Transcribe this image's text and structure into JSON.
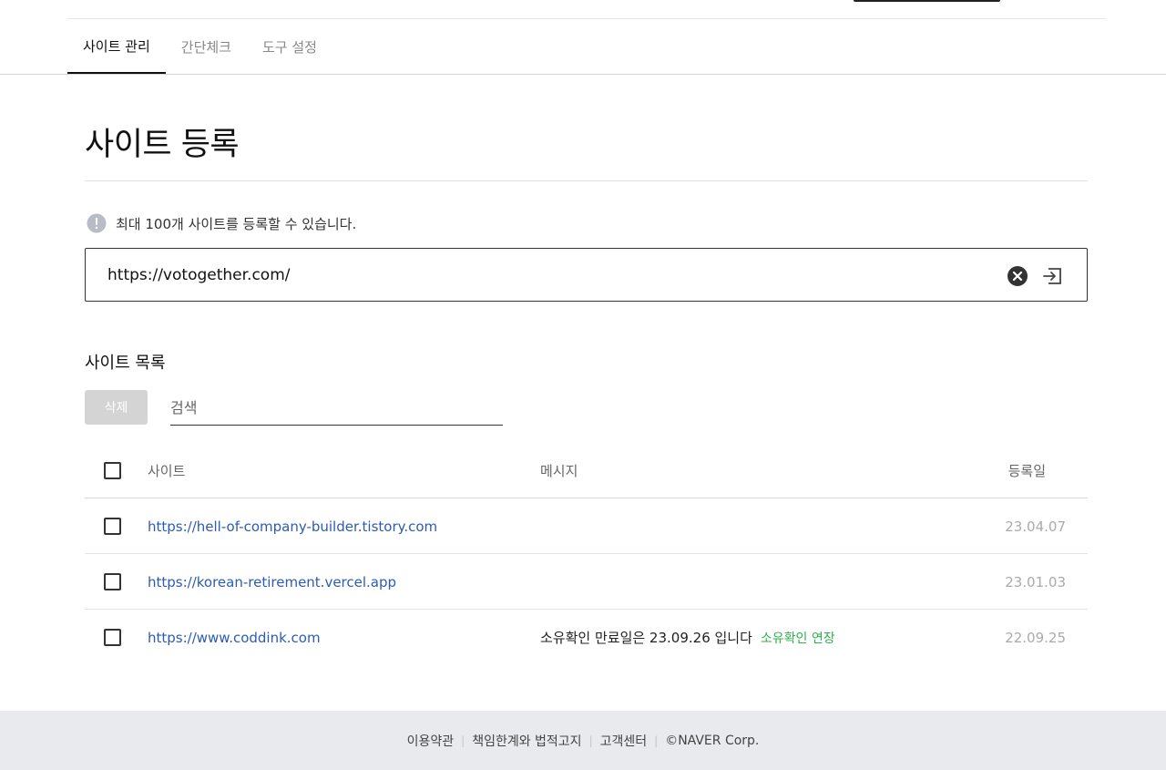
{
  "tabs": [
    {
      "label": "사이트 관리",
      "active": true
    },
    {
      "label": "간단체크",
      "active": false
    },
    {
      "label": "도구 설정",
      "active": false
    }
  ],
  "page": {
    "title": "사이트 등록",
    "notice": "최대 100개 사이트를 등록할 수 있습니다."
  },
  "url_input": {
    "value": "https://votogether.com/"
  },
  "icons": {
    "notice": "info-circle-icon",
    "clear": "clear-x-circle-icon",
    "submit": "enter-submit-icon"
  },
  "site_list": {
    "title": "사이트 목록",
    "delete_label": "삭제",
    "search_placeholder": "검색",
    "columns": {
      "site": "사이트",
      "message": "메시지",
      "date": "등록일"
    },
    "rows": [
      {
        "site": "https://hell-of-company-builder.tistory.com",
        "message": "",
        "action": "",
        "date": "23.04.07"
      },
      {
        "site": "https://korean-retirement.vercel.app",
        "message": "",
        "action": "",
        "date": "23.01.03"
      },
      {
        "site": "https://www.coddink.com",
        "message": "소유확인 만료일은 23.09.26 입니다",
        "action": "소유확인 연장",
        "date": "22.09.25"
      }
    ]
  },
  "footer": {
    "terms": "이용약관",
    "disclaimer": "책임한계와 법적고지",
    "support": "고객센터",
    "copyright": "©NAVER Corp."
  },
  "colors": {
    "link": "#2b5bb8",
    "accent_green": "#2eb04d",
    "footer_bg": "#e9eaed",
    "disabled_button": "#d4d4d4"
  }
}
